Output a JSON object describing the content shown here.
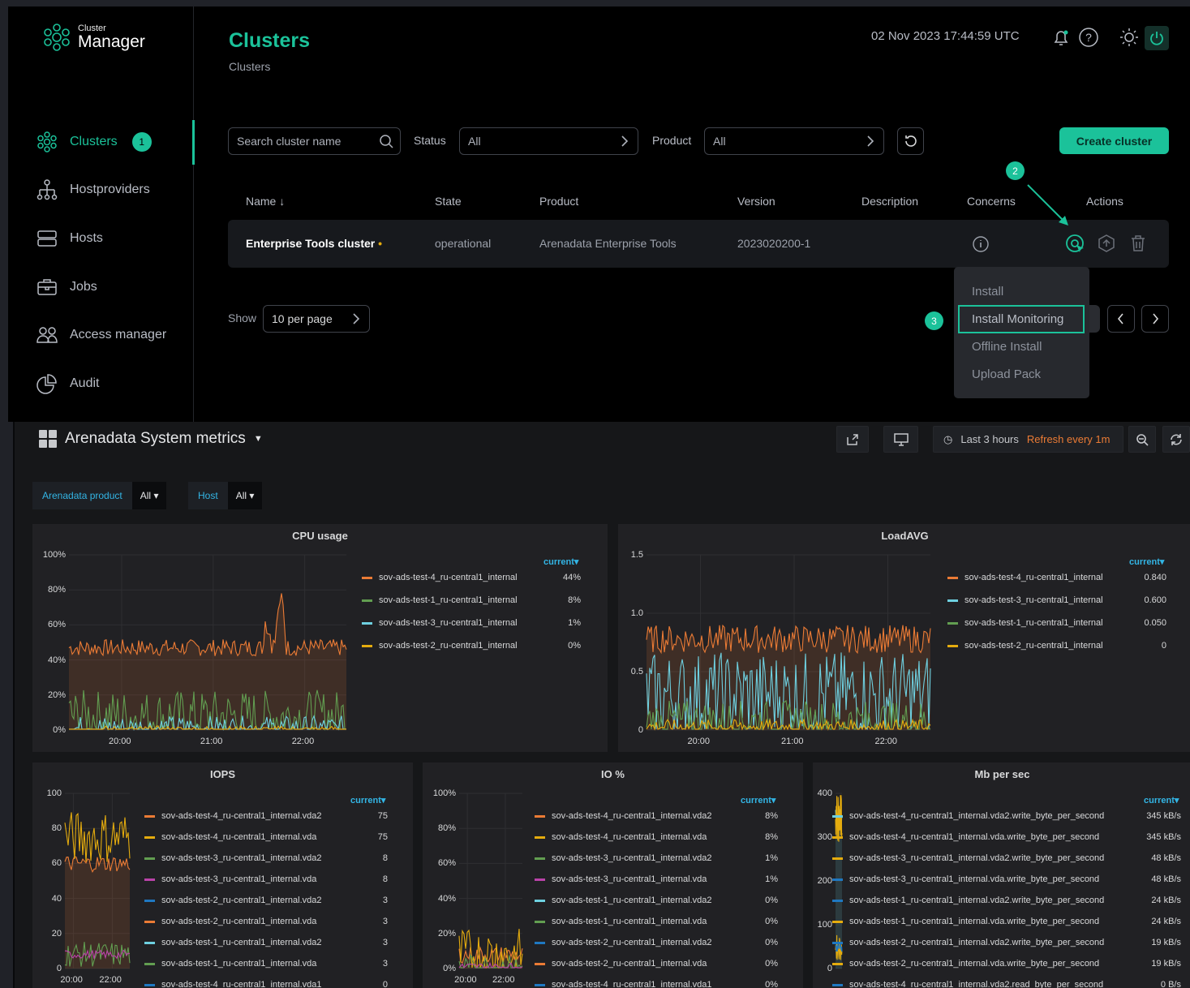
{
  "app": {
    "logo_small": "Cluster",
    "logo_big": "Manager"
  },
  "nav": [
    {
      "label": "Clusters",
      "badge": "1"
    },
    {
      "label": "Hostproviders"
    },
    {
      "label": "Hosts"
    },
    {
      "label": "Jobs"
    },
    {
      "label": "Access manager"
    },
    {
      "label": "Audit"
    }
  ],
  "header": {
    "title": "Clusters",
    "breadcrumb": "Clusters",
    "datetime": "02 Nov 2023  17:44:59  UTC"
  },
  "filters": {
    "search_placeholder": "Search cluster name",
    "status_label": "Status",
    "status_value": "All",
    "product_label": "Product",
    "product_value": "All",
    "create_label": "Create cluster"
  },
  "table": {
    "headers": [
      "Name",
      "State",
      "Product",
      "Version",
      "Description",
      "Concerns",
      "Actions"
    ],
    "row": {
      "name": "Enterprise Tools cluster",
      "state": "operational",
      "product": "Arenadata Enterprise Tools",
      "version": "2023020200-1"
    }
  },
  "steps": [
    "1",
    "2",
    "3"
  ],
  "menu": [
    "Install",
    "Install Monitoring",
    "Offline Install",
    "Upload Pack"
  ],
  "pagination": {
    "show_label": "Show",
    "per_page": "10 per page"
  },
  "dashboard": {
    "title": "Arenadata System metrics",
    "time_range": "Last 3 hours",
    "refresh": "Refresh every 1m",
    "vars": [
      {
        "key": "Arenadata product",
        "value": "All"
      },
      {
        "key": "Host",
        "value": "All"
      }
    ],
    "current_label": "current"
  },
  "colors": {
    "accent": "#1bc29a",
    "orange": "#eb7b35",
    "green": "#629e51",
    "cyan": "#6ed0e0",
    "yellow": "#e5ac0e",
    "purple": "#ba43a9",
    "blue": "#1f78c1",
    "lightblue": "#6ed0e0"
  },
  "chart_data": [
    {
      "type": "line",
      "title": "CPU usage",
      "ylim": [
        0,
        100
      ],
      "yticks": [
        "100%",
        "80%",
        "60%",
        "40%",
        "20%",
        "0%"
      ],
      "xticks": [
        "20:00",
        "21:00",
        "22:00"
      ],
      "series": [
        {
          "name": "sov-ads-test-4_ru-central1_internal",
          "current": "44%",
          "color": "orange"
        },
        {
          "name": "sov-ads-test-1_ru-central1_internal",
          "current": "8%",
          "color": "green"
        },
        {
          "name": "sov-ads-test-3_ru-central1_internal",
          "current": "1%",
          "color": "cyan"
        },
        {
          "name": "sov-ads-test-2_ru-central1_internal",
          "current": "0%",
          "color": "yellow"
        }
      ]
    },
    {
      "type": "line",
      "title": "LoadAVG",
      "ylim": [
        0,
        1.5
      ],
      "yticks": [
        "1.5",
        "1.0",
        "0.5",
        "0"
      ],
      "xticks": [
        "20:00",
        "21:00",
        "22:00"
      ],
      "series": [
        {
          "name": "sov-ads-test-4_ru-central1_internal",
          "current": "0.840",
          "color": "orange"
        },
        {
          "name": "sov-ads-test-3_ru-central1_internal",
          "current": "0.600",
          "color": "cyan"
        },
        {
          "name": "sov-ads-test-1_ru-central1_internal",
          "current": "0.050",
          "color": "green"
        },
        {
          "name": "sov-ads-test-2_ru-central1_internal",
          "current": "0",
          "color": "yellow"
        }
      ]
    },
    {
      "type": "line",
      "title": "IOPS",
      "ylim": [
        0,
        100
      ],
      "yticks": [
        "100",
        "80",
        "60",
        "40",
        "20",
        "0"
      ],
      "xticks": [
        "20:00",
        "22:00"
      ],
      "series": [
        {
          "name": "sov-ads-test-4_ru-central1_internal.vda2",
          "current": "75",
          "color": "orange"
        },
        {
          "name": "sov-ads-test-4_ru-central1_internal.vda",
          "current": "75",
          "color": "yellow"
        },
        {
          "name": "sov-ads-test-3_ru-central1_internal.vda2",
          "current": "8",
          "color": "green"
        },
        {
          "name": "sov-ads-test-3_ru-central1_internal.vda",
          "current": "8",
          "color": "purple"
        },
        {
          "name": "sov-ads-test-2_ru-central1_internal.vda2",
          "current": "3",
          "color": "blue"
        },
        {
          "name": "sov-ads-test-2_ru-central1_internal.vda",
          "current": "3",
          "color": "orange"
        },
        {
          "name": "sov-ads-test-1_ru-central1_internal.vda2",
          "current": "3",
          "color": "lightblue"
        },
        {
          "name": "sov-ads-test-1_ru-central1_internal.vda",
          "current": "3",
          "color": "green"
        },
        {
          "name": "sov-ads-test-4_ru-central1_internal.vda1",
          "current": "0",
          "color": "blue"
        }
      ]
    },
    {
      "type": "line",
      "title": "IO %",
      "ylim": [
        0,
        100
      ],
      "yticks": [
        "100%",
        "80%",
        "60%",
        "40%",
        "20%",
        "0%"
      ],
      "xticks": [
        "20:00",
        "22:00"
      ],
      "series": [
        {
          "name": "sov-ads-test-4_ru-central1_internal.vda2",
          "current": "8%",
          "color": "orange"
        },
        {
          "name": "sov-ads-test-4_ru-central1_internal.vda",
          "current": "8%",
          "color": "yellow"
        },
        {
          "name": "sov-ads-test-3_ru-central1_internal.vda2",
          "current": "1%",
          "color": "green"
        },
        {
          "name": "sov-ads-test-3_ru-central1_internal.vda",
          "current": "1%",
          "color": "purple"
        },
        {
          "name": "sov-ads-test-1_ru-central1_internal.vda2",
          "current": "0%",
          "color": "lightblue"
        },
        {
          "name": "sov-ads-test-1_ru-central1_internal.vda",
          "current": "0%",
          "color": "green"
        },
        {
          "name": "sov-ads-test-2_ru-central1_internal.vda2",
          "current": "0%",
          "color": "blue"
        },
        {
          "name": "sov-ads-test-2_ru-central1_internal.vda",
          "current": "0%",
          "color": "orange"
        },
        {
          "name": "sov-ads-test-4_ru-central1_internal.vda1",
          "current": "0%",
          "color": "blue"
        }
      ]
    },
    {
      "type": "line",
      "title": "Mb per sec",
      "yticks": [
        "400",
        "300",
        "200",
        "100",
        "0"
      ],
      "series": [
        {
          "name": "sov-ads-test-4_ru-central1_internal.vda2.write_byte_per_second",
          "current": "345 kB/s",
          "color": "lightblue"
        },
        {
          "name": "sov-ads-test-4_ru-central1_internal.vda.write_byte_per_second",
          "current": "345 kB/s",
          "color": "yellow"
        },
        {
          "name": "sov-ads-test-3_ru-central1_internal.vda2.write_byte_per_second",
          "current": "48 kB/s",
          "color": "yellow"
        },
        {
          "name": "sov-ads-test-3_ru-central1_internal.vda.write_byte_per_second",
          "current": "48 kB/s",
          "color": "blue"
        },
        {
          "name": "sov-ads-test-1_ru-central1_internal.vda2.write_byte_per_second",
          "current": "24 kB/s",
          "color": "blue"
        },
        {
          "name": "sov-ads-test-1_ru-central1_internal.vda.write_byte_per_second",
          "current": "24 kB/s",
          "color": "yellow"
        },
        {
          "name": "sov-ads-test-2_ru-central1_internal.vda2.write_byte_per_second",
          "current": "19 kB/s",
          "color": "blue"
        },
        {
          "name": "sov-ads-test-2_ru-central1_internal.vda.write_byte_per_second",
          "current": "19 kB/s",
          "color": "yellow"
        },
        {
          "name": "sov-ads-test-4_ru-central1_internal.vda2.read_byte_per_second",
          "current": "0 B/s",
          "color": "blue"
        }
      ]
    }
  ]
}
